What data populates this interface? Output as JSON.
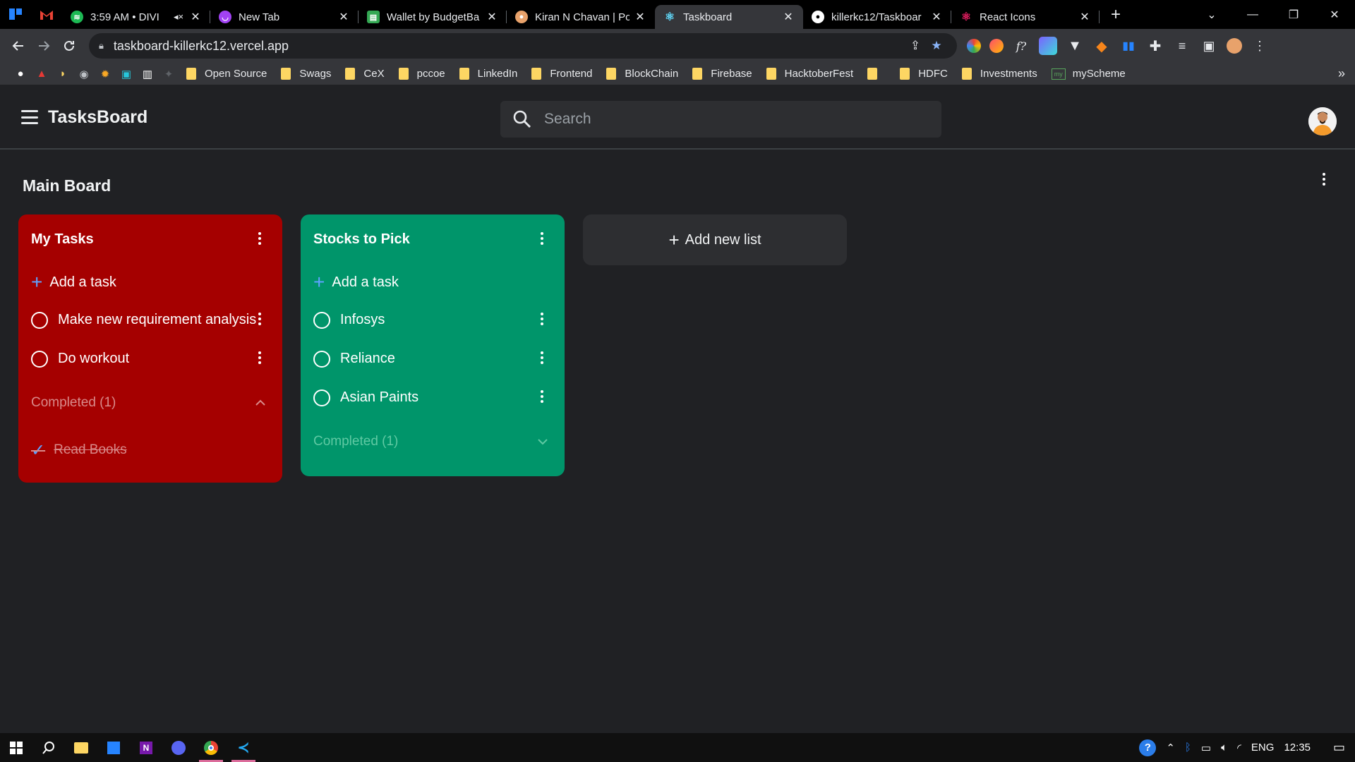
{
  "browser": {
    "tabs": [
      {
        "title": "3:59 AM • DIVI",
        "favicon": "spotify-icon",
        "color": "#1db954",
        "muted": true
      },
      {
        "title": "New Tab",
        "favicon": "new-tab-icon",
        "color": "#a142f4"
      },
      {
        "title": "Wallet by BudgetBa",
        "favicon": "wallet-icon",
        "color": "#34a853"
      },
      {
        "title": "Kiran N Chavan | Po",
        "favicon": "person-icon",
        "color": "#e8a26b"
      },
      {
        "title": "Taskboard",
        "favicon": "react-icon",
        "color": "#61dafb",
        "active": true
      },
      {
        "title": "killerkc12/Taskboar",
        "favicon": "github-icon",
        "color": "#ffffff"
      },
      {
        "title": "React Icons",
        "favicon": "react-icon",
        "color": "#e91e63"
      }
    ],
    "url": "taskboard-killerkc12.vercel.app",
    "bookmarks": [
      {
        "label": "Open Source"
      },
      {
        "label": "Swags"
      },
      {
        "label": "CeX"
      },
      {
        "label": "pccoe"
      },
      {
        "label": "LinkedIn"
      },
      {
        "label": "Frontend"
      },
      {
        "label": "BlockChain"
      },
      {
        "label": "Firebase"
      },
      {
        "label": "HacktoberFest"
      },
      {
        "label": ""
      },
      {
        "label": "HDFC"
      },
      {
        "label": "Investments"
      }
    ],
    "bookmark_scheme": {
      "label": "myScheme",
      "badge": "my"
    },
    "bookmark_more": "»"
  },
  "app": {
    "brand": "TasksBoard",
    "search_placeholder": "Search",
    "board_title": "Main Board",
    "add_list_label": "Add new list",
    "lists": [
      {
        "name": "My Tasks",
        "color": "#a50000",
        "add_task_label": "Add a task",
        "tasks": [
          "Make new requirement analysis",
          "Do workout"
        ],
        "completed_label": "Completed (1)",
        "completed_expanded": true,
        "completed_tasks": [
          "Read Books"
        ]
      },
      {
        "name": "Stocks to Pick",
        "color": "#00956a",
        "add_task_label": "Add a task",
        "tasks": [
          "Infosys",
          "Reliance",
          "Asian Paints"
        ],
        "completed_label": "Completed (1)",
        "completed_expanded": false,
        "completed_tasks": []
      }
    ]
  },
  "taskbar": {
    "language": "ENG",
    "time": "12:35"
  }
}
